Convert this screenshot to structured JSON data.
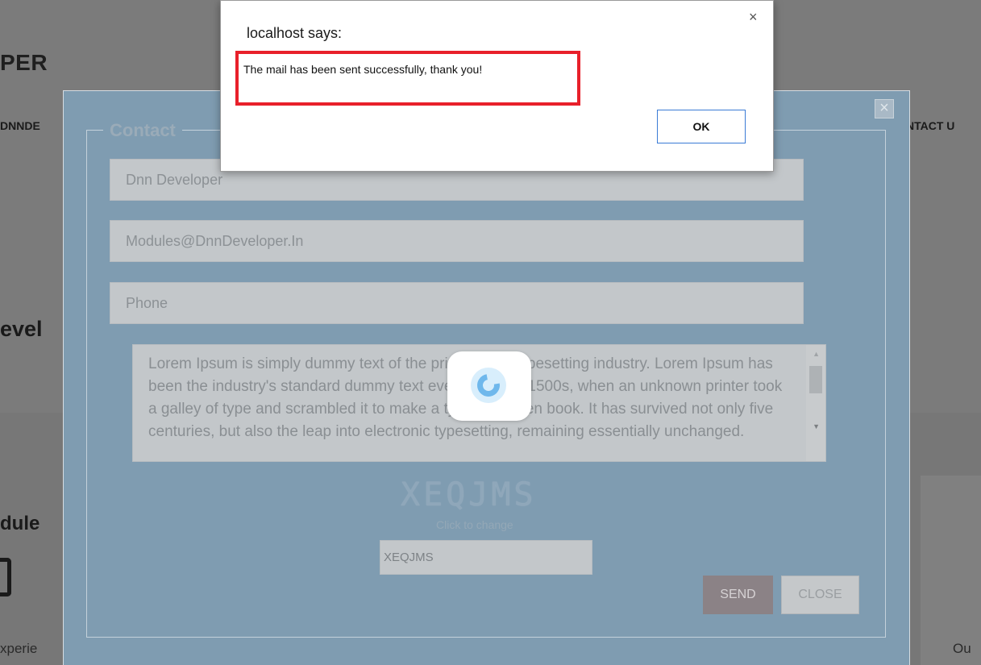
{
  "background": {
    "site_title": "PER",
    "nav_left": "DNNDE",
    "nav_right": "NTACT U",
    "heading_1": "evel",
    "heading_2": "dule",
    "text_left": "xperie",
    "text_right": "Ou"
  },
  "modal": {
    "close_icon": "×",
    "legend": "Contact",
    "name_value": "Dnn Developer",
    "email_value": "Modules@DnnDeveloper.In",
    "phone_placeholder": "Phone",
    "message_value": "Lorem Ipsum is simply dummy text of the printing and typesetting industry. Lorem Ipsum has been the industry's standard dummy text ever since the 1500s, when an unknown printer took a galley of type and scrambled it to make a type specimen book. It has survived not only five centuries, but also the leap into electronic typesetting, remaining essentially unchanged.",
    "captcha_image_text": "XEQJMS",
    "captcha_hint": "Click to change",
    "captcha_input_value": "XEQJMS",
    "send_label": "SEND",
    "close_label": "CLOSE"
  },
  "alert": {
    "title": "localhost says:",
    "message": "The mail has been sent successfully, thank you!",
    "ok_label": "OK",
    "close_icon": "×",
    "highlight_color": "#e8202a"
  },
  "colors": {
    "modal_bg": "#7f9cb1",
    "send_button": "#8b8286",
    "alert_ok_border": "#3a7bd5"
  }
}
